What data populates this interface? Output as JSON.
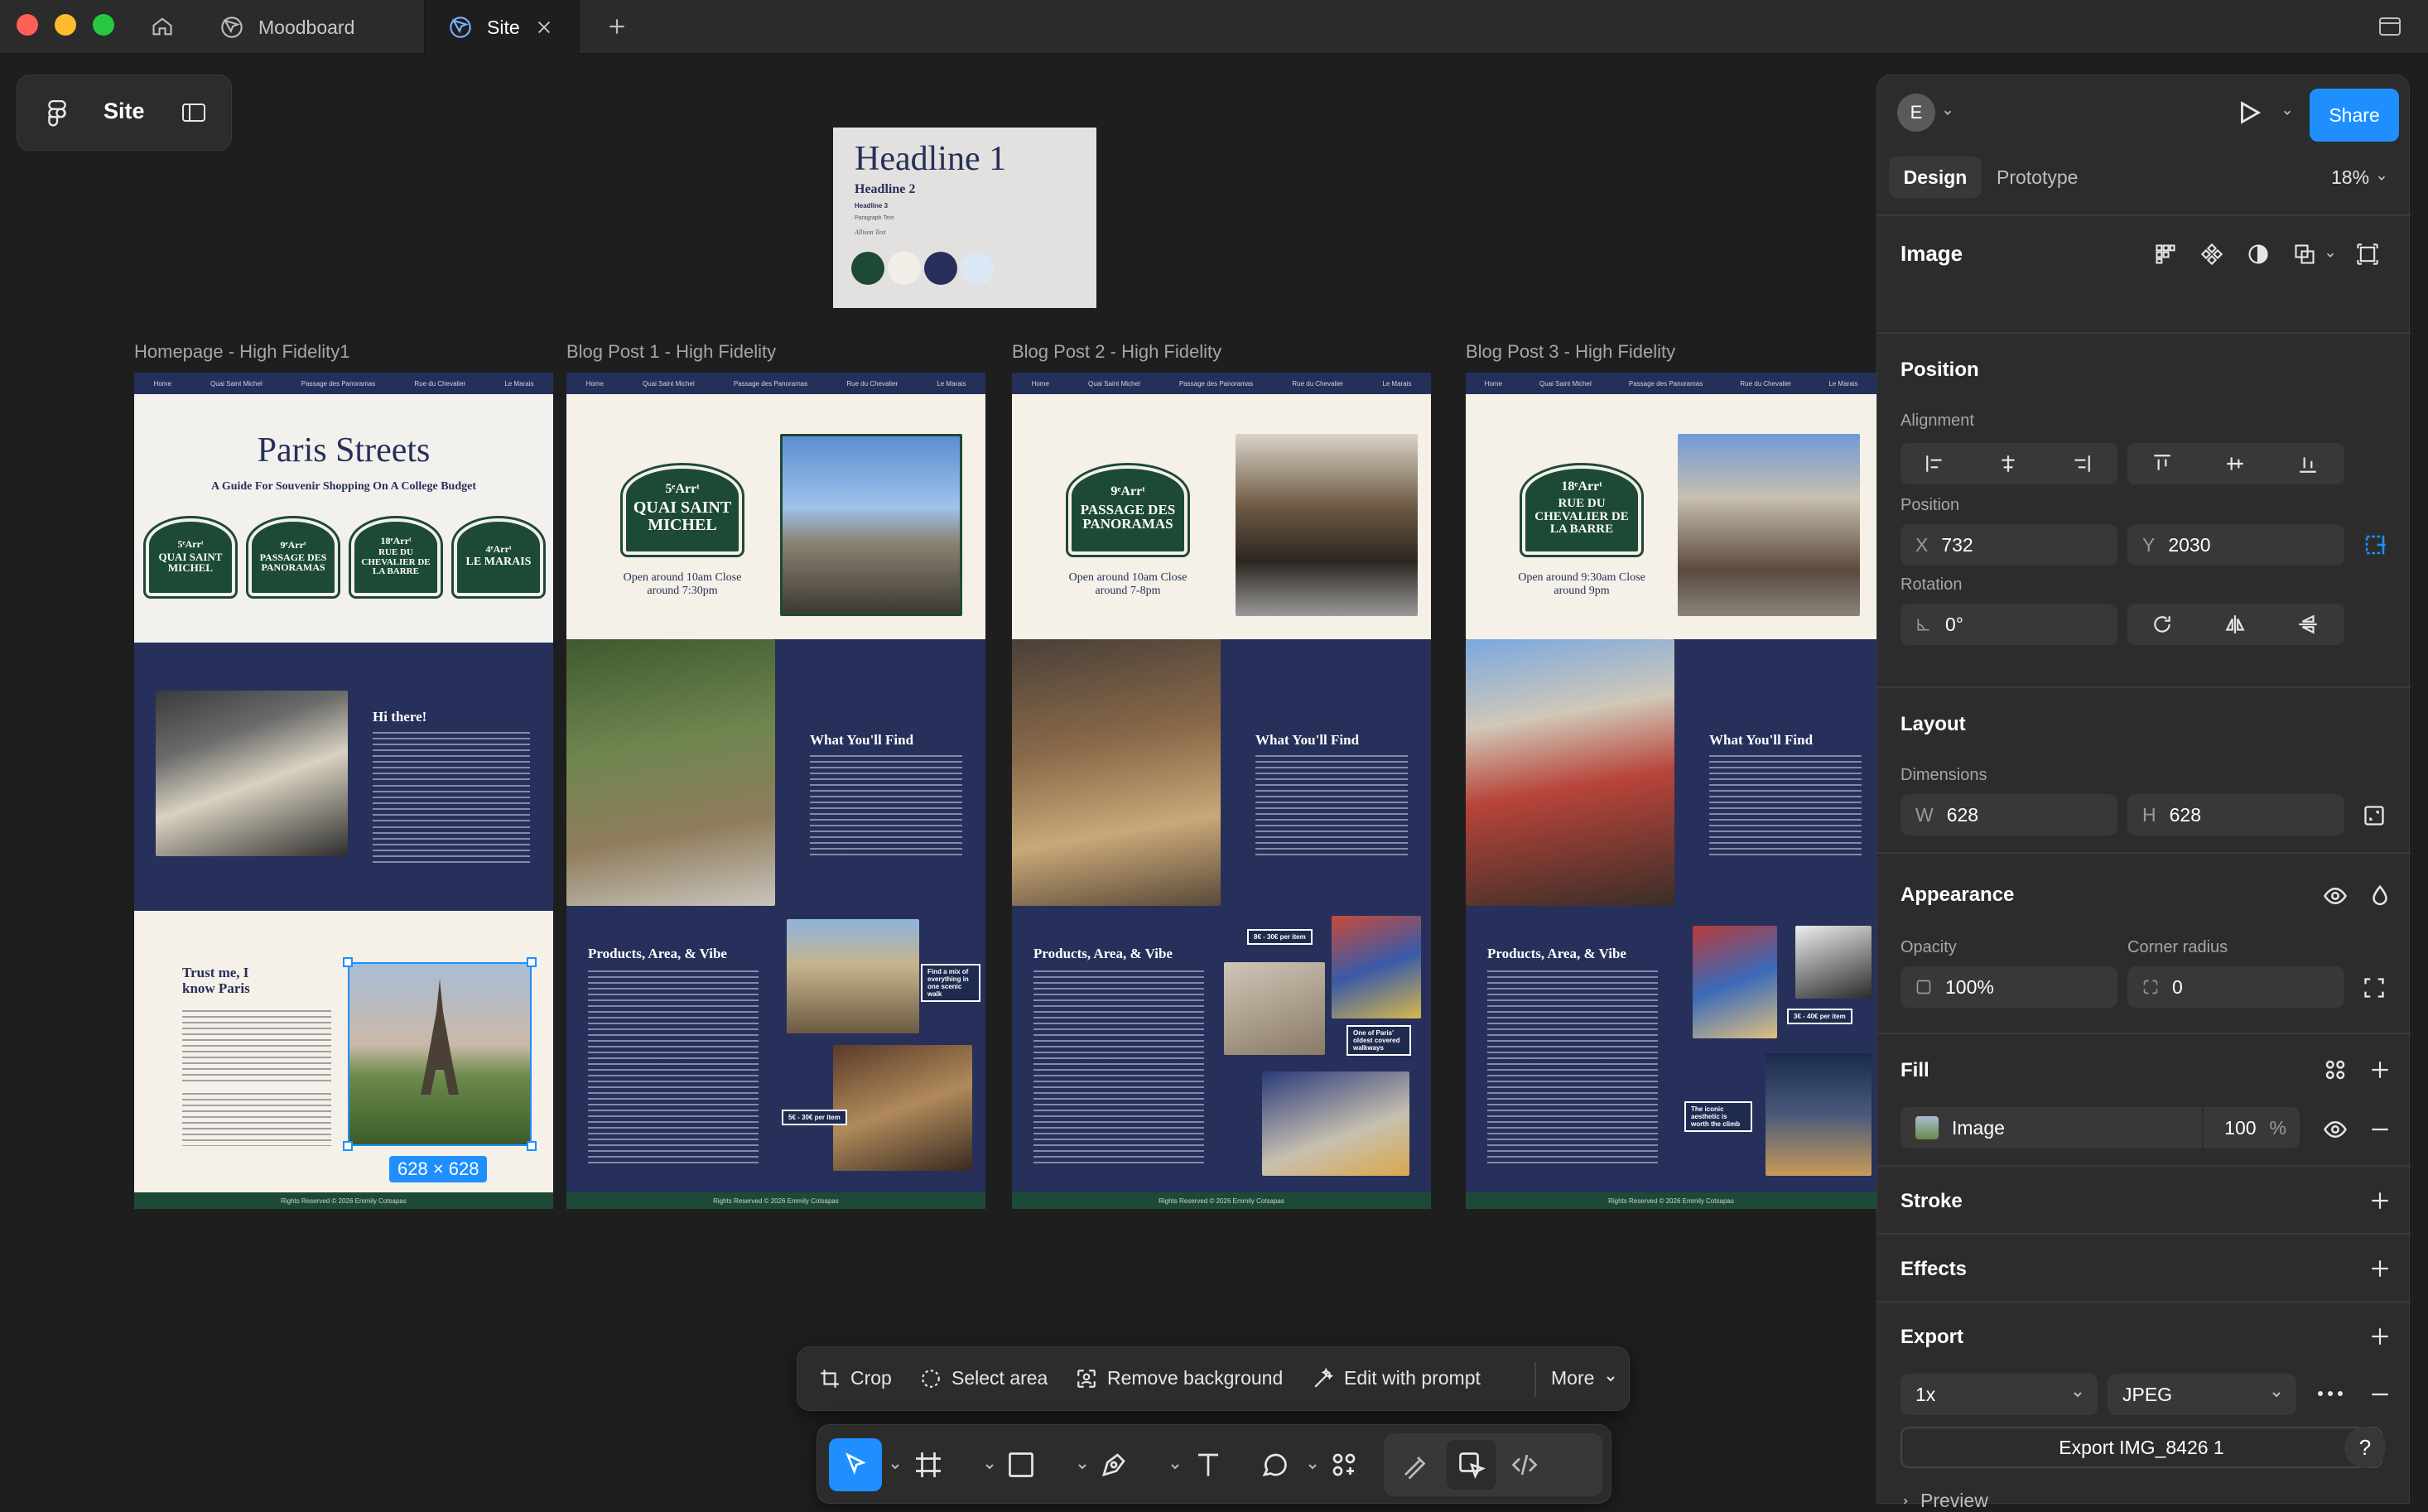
{
  "tabs": {
    "home_icon": "home-icon",
    "moodboard": "Moodboard",
    "site": "Site",
    "add_icon": "plus-icon"
  },
  "file_chip": {
    "name": "Site"
  },
  "style_card": {
    "headline1": "Headline 1",
    "headline2": "Headline 2",
    "headline3": "Headline 3",
    "paragraph": "Paragraph Text",
    "script": "Allison Text",
    "swatches": [
      "#1d4a36",
      "#f3efe8",
      "#27305a",
      "#dde8f6"
    ]
  },
  "frames": [
    {
      "label": "Homepage - High Fidelity1",
      "title": "Paris Streets",
      "subtitle": "A Guide For Souvenir Shopping On A College Budget",
      "hi": "Hi there!",
      "trust": "Trust me, I know Paris",
      "signs": [
        {
          "arr": "5ᵉArrᵗ",
          "name": "QUAI SAINT MICHEL"
        },
        {
          "arr": "9ᵉArrᵗ",
          "name": "PASSAGE DES PANORAMAS"
        },
        {
          "arr": "18ᵉArrᵗ",
          "name": "RUE DU CHEVALIER DE LA BARRE"
        },
        {
          "arr": "4ᵉArrᵗ",
          "name": "LE MARAIS"
        }
      ],
      "footer": "Rights Reserved © 2026 Emmily Cotsapas"
    },
    {
      "label": "Blog Post 1 - High Fidelity",
      "sign_arr": "5ᵉArrᵗ",
      "sign_name": "QUAI SAINT MICHEL",
      "hours": "Open around 10am Close around 7:30pm",
      "find": "What You'll Find",
      "products": "Products, Area, & Vibe",
      "tags": [
        "Find a mix of everything in one scenic walk",
        "5€ - 30€ per item"
      ],
      "footer": "Rights Reserved © 2026 Emmily Cotsapas"
    },
    {
      "label": "Blog Post 2 - High Fidelity",
      "sign_arr": "9ᵉArrᵗ",
      "sign_name": "PASSAGE DES PANORAMAS",
      "hours": "Open around 10am Close around 7-8pm",
      "find": "What You'll Find",
      "products": "Products, Area, & Vibe",
      "tags": [
        "8€ - 30€ per item",
        "One of Paris' oldest covered walkways"
      ],
      "footer": "Rights Reserved © 2026 Emmily Cotsapas"
    },
    {
      "label": "Blog Post 3 - High Fidelity",
      "sign_arr": "18ᵉArrᵗ",
      "sign_name": "RUE DU CHEVALIER DE LA BARRE",
      "hours": "Open around 9:30am Close around 9pm",
      "find": "What You'll Find",
      "products": "Products, Area, & Vibe",
      "tags": [
        "3€ - 40€ per item",
        "The iconic aesthetic is worth the climb"
      ],
      "footer": "Rights Reserved © 2026 Emmily Cotsapas"
    }
  ],
  "selection": {
    "size_label": "628 × 628"
  },
  "nav_items": [
    "Home",
    "Quai Saint Michel",
    "Passage des Panoramas",
    "Rue du Chevalier",
    "Le Marais"
  ],
  "image_toolbar": {
    "crop": "Crop",
    "select_area": "Select area",
    "remove_bg": "Remove background",
    "edit_prompt": "Edit with prompt",
    "more": "More"
  },
  "panel": {
    "avatar": "E",
    "share": "Share",
    "tab_design": "Design",
    "tab_prototype": "Prototype",
    "zoom": "18%",
    "layer_type": "Image",
    "position_title": "Position",
    "alignment_label": "Alignment",
    "position_label": "Position",
    "x_key": "X",
    "x_val": "732",
    "y_key": "Y",
    "y_val": "2030",
    "rotation_label": "Rotation",
    "rotation_val": "0°",
    "layout_title": "Layout",
    "dimensions_label": "Dimensions",
    "w_key": "W",
    "w_val": "628",
    "h_key": "H",
    "h_val": "628",
    "appearance_title": "Appearance",
    "opacity_label": "Opacity",
    "opacity_val": "100%",
    "radius_label": "Corner radius",
    "radius_val": "0",
    "fill_title": "Fill",
    "fill_type": "Image",
    "fill_opacity": "100",
    "fill_pct": "%",
    "stroke_title": "Stroke",
    "effects_title": "Effects",
    "export_title": "Export",
    "export_scale": "1x",
    "export_format": "JPEG",
    "export_button": "Export IMG_8426 1",
    "preview": "Preview",
    "help": "?"
  }
}
